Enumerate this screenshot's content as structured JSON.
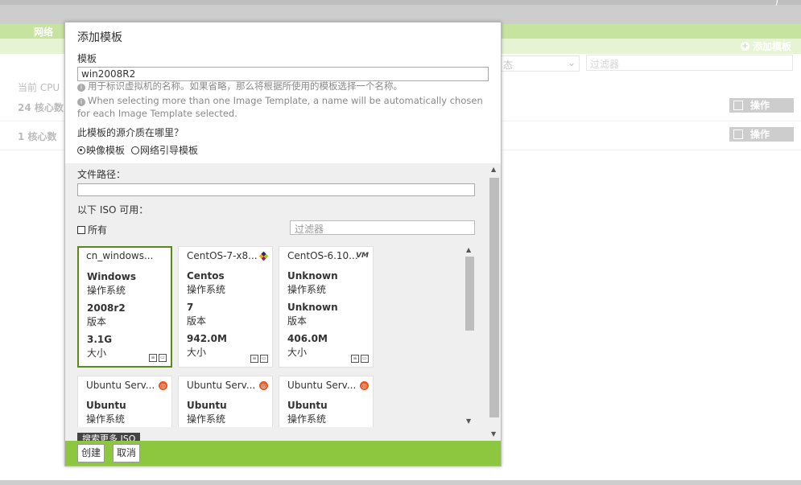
{
  "background": {
    "top_right_text": ")",
    "nav_tab": "网络",
    "add_template": "添加模板",
    "select_value": "态",
    "filter_placeholder": "过滤器",
    "cpu_label": "当前 CPU",
    "rows": [
      {
        "label": "24 核心数",
        "action": "操作"
      },
      {
        "label": "1 核心数",
        "action": "操作"
      }
    ]
  },
  "dialog": {
    "title": "添加模板",
    "template_label": "模板",
    "template_value": "win2008R2",
    "hint_cn": "用于标识虚拟机的名称。如果省略，那么将根据所使用的模板选择一个名称。",
    "hint_en": "When selecting more than one Image Template, a name will be automatically chosen for each Image Template selected.",
    "source_question": "此模板的源介质在哪里？",
    "source_options": [
      {
        "label": "映像模板",
        "selected": true
      },
      {
        "label": "网络引导模板",
        "selected": false
      }
    ],
    "file_path_label": "文件路径：",
    "file_path_value": "",
    "iso_available_label": "以下 ISO 可用：",
    "all_label": "所有",
    "all_checked": false,
    "iso_filter_placeholder": "过滤器",
    "iso_list": [
      {
        "name": "cn_windows...",
        "logo": "windows",
        "os": "Windows",
        "os_label": "操作系统",
        "version": "2008r2",
        "version_label": "版本",
        "size": "3.1G",
        "size_label": "大小",
        "selected": true
      },
      {
        "name": "CentOS-7-x8...",
        "logo": "centos-logo",
        "os": "Centos",
        "os_label": "操作系统",
        "version": "7",
        "version_label": "版本",
        "size": "942.0M",
        "size_label": "大小",
        "selected": false
      },
      {
        "name": "CentOS-6.10...",
        "logo": "vm-logo",
        "logo_text": "VM",
        "os": "Unknown",
        "os_label": "操作系统",
        "version": "Unknown",
        "version_label": "版本",
        "size": "406.0M",
        "size_label": "大小",
        "selected": false
      },
      {
        "name": "Ubuntu Serv...",
        "logo": "ubuntu-logo",
        "os": "Ubuntu",
        "os_label": "操作系统"
      },
      {
        "name": "Ubuntu Serv...",
        "logo": "ubuntu-logo",
        "os": "Ubuntu",
        "os_label": "操作系统"
      },
      {
        "name": "Ubuntu Serv...",
        "logo": "ubuntu-logo",
        "os": "Ubuntu",
        "os_label": "操作系统"
      }
    ],
    "search_more": "搜索更多 ISO",
    "create_button": "创建",
    "cancel_button": "取消"
  },
  "colors": {
    "accent_green": "#8dc63f",
    "selected_border": "#5a8a1a",
    "header_gray": "#9a9a9a"
  }
}
